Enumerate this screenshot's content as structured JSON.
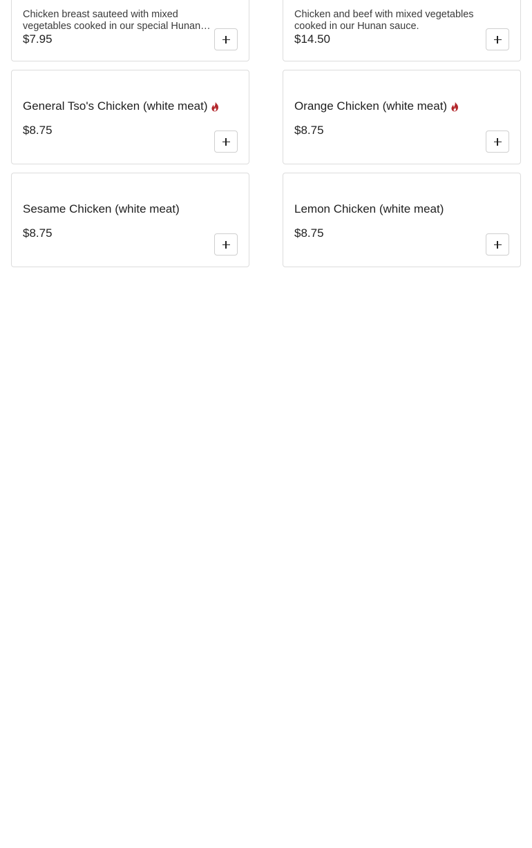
{
  "menu": {
    "items": [
      {
        "name": "",
        "description": "Chicken breast sauteed with mixed vegetables cooked in our special Hunan sauce.",
        "price": "$7.95",
        "spicy": false
      },
      {
        "name": "",
        "description": "Chicken and beef with mixed vegetables cooked in our Hunan sauce.",
        "price": "$14.50",
        "spicy": false
      },
      {
        "name": "General Tso's Chicken (white meat)",
        "description": "",
        "price": "$8.75",
        "spicy": true
      },
      {
        "name": "Orange Chicken (white meat)",
        "description": "",
        "price": "$8.75",
        "spicy": true
      },
      {
        "name": "Sesame Chicken (white meat)",
        "description": "",
        "price": "$8.75",
        "spicy": false
      },
      {
        "name": "Lemon Chicken (white meat)",
        "description": "",
        "price": "$8.75",
        "spicy": false
      }
    ],
    "add_icon": "plus-icon",
    "spicy_icon": "chili-pepper-icon"
  },
  "colors": {
    "spicy": "#b3262b",
    "card_border": "#dcdcdc",
    "text": "#1f1f1f"
  }
}
